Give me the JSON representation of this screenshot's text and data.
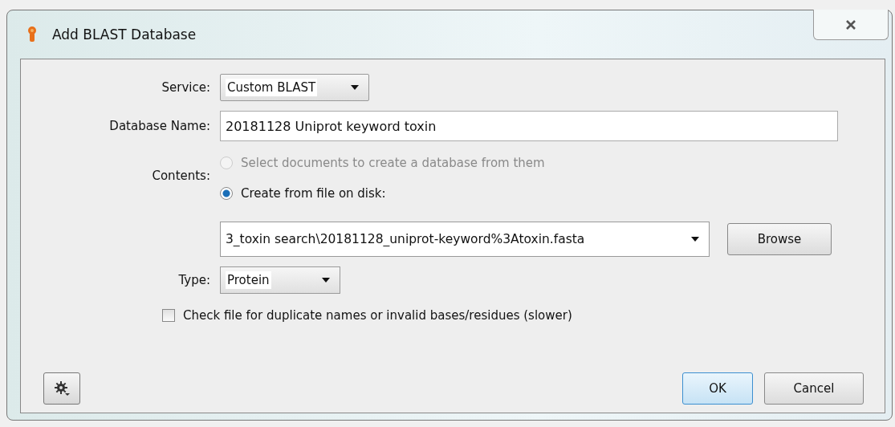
{
  "window": {
    "title": "Add BLAST Database"
  },
  "service": {
    "label": "Service:",
    "value": "Custom BLAST"
  },
  "database_name": {
    "label": "Database Name:",
    "value": "20181128 Uniprot keyword toxin"
  },
  "contents": {
    "label": "Contents:",
    "options": [
      {
        "label": "Select documents to create a database from them",
        "selected": false,
        "disabled": true
      },
      {
        "label": "Create from file on disk:",
        "selected": true,
        "disabled": false
      }
    ]
  },
  "file": {
    "value": "3_toxin search\\20181128_uniprot-keyword%3Atoxin.fasta",
    "button": "Browse"
  },
  "type": {
    "label": "Type:",
    "value": "Protein"
  },
  "check_file": {
    "label": "Check file for duplicate names or invalid bases/residues (slower)",
    "checked": false
  },
  "buttons": [
    {
      "label": "OK",
      "default": true
    },
    {
      "label": "Cancel",
      "default": false
    }
  ]
}
